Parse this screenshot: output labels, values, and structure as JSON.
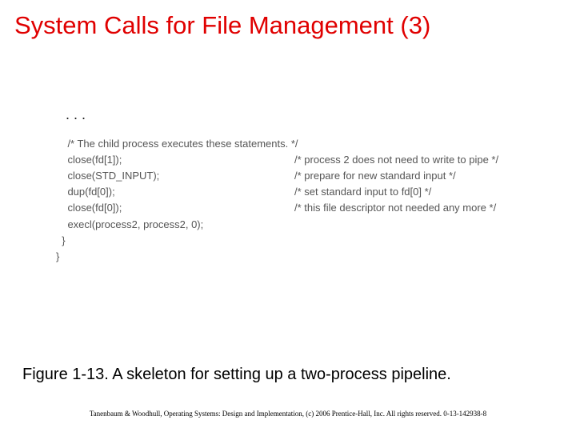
{
  "title": "System Calls for File Management (3)",
  "ellipsis": ". . .",
  "code": {
    "commentHeader": "    /* The child process executes these statements. */",
    "lines": [
      {
        "code": "    close(fd[1]);",
        "comment": "/* process 2 does not need to write to pipe */"
      },
      {
        "code": "    close(STD_INPUT);",
        "comment": "/* prepare for new standard input */"
      },
      {
        "code": "    dup(fd[0]);",
        "comment": "/* set standard input to fd[0] */"
      },
      {
        "code": "    close(fd[0]);",
        "comment": "/* this file descriptor not needed any more */"
      },
      {
        "code": "    execl(process2, process2, 0);",
        "comment": ""
      }
    ],
    "brace1": "  }",
    "brace2": "}"
  },
  "caption": "Figure 1-13. A skeleton for setting up a two-process pipeline.",
  "footer": "Tanenbaum & Woodhull, Operating Systems: Design and Implementation, (c) 2006 Prentice-Hall, Inc. All rights reserved. 0-13-142938-8"
}
